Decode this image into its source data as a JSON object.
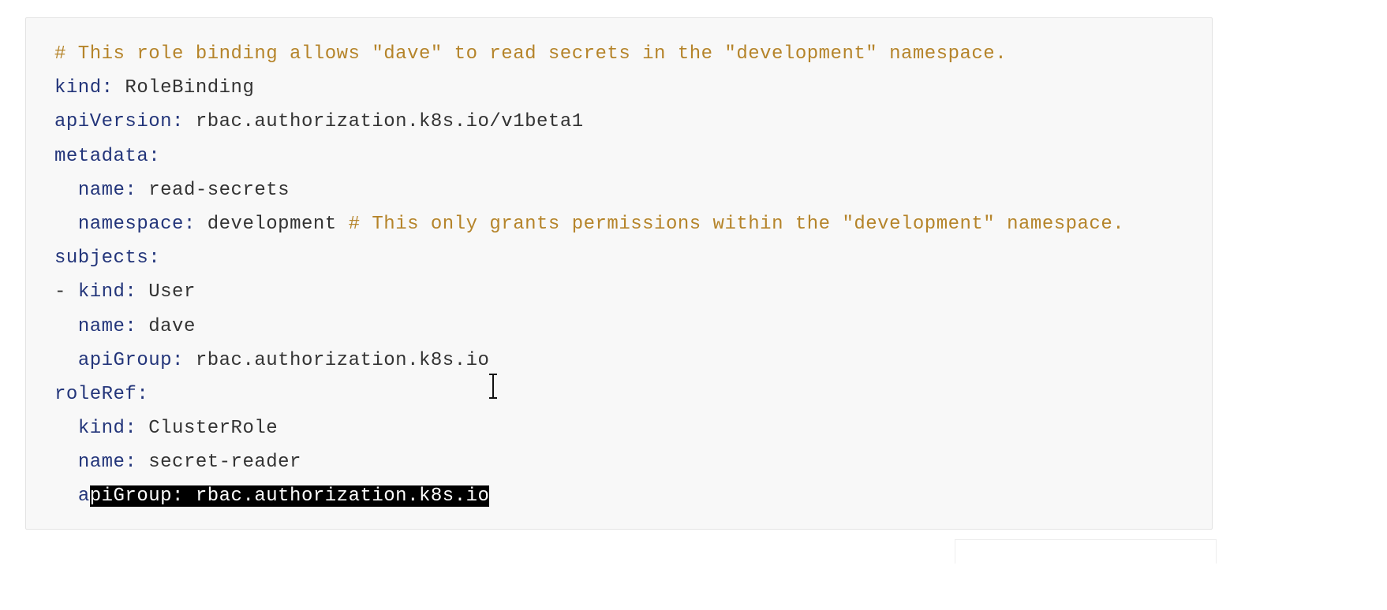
{
  "code": {
    "lines": [
      {
        "indent": "",
        "key": "",
        "value": "",
        "comment": "# This role binding allows \"dave\" to read secrets in the \"development\" namespace."
      },
      {
        "indent": "",
        "key": "kind:",
        "value": " RoleBinding",
        "comment": ""
      },
      {
        "indent": "",
        "key": "apiVersion:",
        "value": " rbac.authorization.k8s.io/v1beta1",
        "comment": ""
      },
      {
        "indent": "",
        "key": "metadata:",
        "value": "",
        "comment": ""
      },
      {
        "indent": "  ",
        "key": "name:",
        "value": " read-secrets",
        "comment": ""
      },
      {
        "indent": "  ",
        "key": "namespace:",
        "value": " development ",
        "comment": "# This only grants permissions within the \"development\" namespace."
      },
      {
        "indent": "",
        "key": "subjects:",
        "value": "",
        "comment": ""
      },
      {
        "indent": "- ",
        "key": "kind:",
        "value": " User",
        "comment": ""
      },
      {
        "indent": "  ",
        "key": "name:",
        "value": " dave",
        "comment": ""
      },
      {
        "indent": "  ",
        "key": "apiGroup:",
        "value": " rbac.authorization.k8s.io",
        "comment": ""
      },
      {
        "indent": "",
        "key": "roleRef:",
        "value": "",
        "comment": ""
      },
      {
        "indent": "  ",
        "key": "kind:",
        "value": " ClusterRole",
        "comment": ""
      },
      {
        "indent": "  ",
        "key": "name:",
        "value": " secret-reader",
        "comment": ""
      }
    ],
    "last_line": {
      "indent": "  ",
      "unselected": "a",
      "selected": "piGroup: rbac.authorization.k8s.io"
    }
  }
}
